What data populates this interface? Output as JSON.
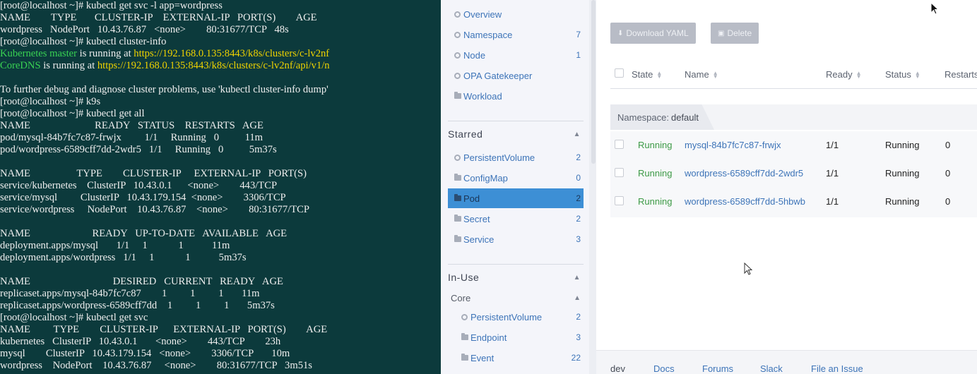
{
  "terminal": {
    "lines": [
      [
        {
          "t": "[root@localhost ~]# kubectl get svc -l app=wordpress"
        }
      ],
      [
        {
          "t": "NAME        TYPE       CLUSTER-IP    EXTERNAL-IP   PORT(S)        AGE"
        }
      ],
      [
        {
          "t": "wordpress   NodePort   10.43.76.87   <none>        80:31677/TCP   48s"
        }
      ],
      [
        {
          "t": "[root@localhost ~]# kubectl cluster-info"
        }
      ],
      [
        {
          "t": "Kubernetes master",
          "c": "g"
        },
        {
          "t": " is running at "
        },
        {
          "t": "https://192.168.0.135:8443/k8s/clusters/c-lv2nf",
          "c": "y"
        }
      ],
      [
        {
          "t": "CoreDNS",
          "c": "g"
        },
        {
          "t": " is running at "
        },
        {
          "t": "https://192.168.0.135:8443/k8s/clusters/c-lv2nf/api/v1/n",
          "c": "y"
        }
      ],
      [
        {
          "t": ""
        }
      ],
      [
        {
          "t": "To further debug and diagnose cluster problems, use 'kubectl cluster-info dump'"
        }
      ],
      [
        {
          "t": "[root@localhost ~]# k9s"
        }
      ],
      [
        {
          "t": "[root@localhost ~]# kubectl get all"
        }
      ],
      [
        {
          "t": "NAME                         READY   STATUS    RESTARTS   AGE"
        }
      ],
      [
        {
          "t": "pod/mysql-84b7fc7c87-frwjx         1/1     Running   0          11m"
        }
      ],
      [
        {
          "t": "pod/wordpress-6589cff7dd-2wdr5   1/1     Running   0          5m37s"
        }
      ],
      [
        {
          "t": ""
        }
      ],
      [
        {
          "t": "NAME                  TYPE        CLUSTER-IP     EXTERNAL-IP   PORT(S)"
        }
      ],
      [
        {
          "t": "service/kubernetes    ClusterIP   10.43.0.1      <none>        443/TCP"
        }
      ],
      [
        {
          "t": "service/mysql         ClusterIP   10.43.179.154  <none>        3306/TCP"
        }
      ],
      [
        {
          "t": "service/wordpress     NodePort    10.43.76.87    <none>        80:31677/TCP"
        }
      ],
      [
        {
          "t": ""
        }
      ],
      [
        {
          "t": "NAME                        READY   UP-TO-DATE   AVAILABLE   AGE"
        }
      ],
      [
        {
          "t": "deployment.apps/mysql       1/1     1            1           11m"
        }
      ],
      [
        {
          "t": "deployment.apps/wordpress   1/1     1            1           5m37s"
        }
      ],
      [
        {
          "t": ""
        }
      ],
      [
        {
          "t": "NAME                                DESIRED   CURRENT   READY   AGE"
        }
      ],
      [
        {
          "t": "replicaset.apps/mysql-84b7fc7c87        1         1         1       11m"
        }
      ],
      [
        {
          "t": "replicaset.apps/wordpress-6589cff7dd    1         1         1       5m37s"
        }
      ],
      [
        {
          "t": "[root@localhost ~]# kubectl get svc"
        }
      ],
      [
        {
          "t": "NAME         TYPE        CLUSTER-IP      EXTERNAL-IP   PORT(S)        AGE"
        }
      ],
      [
        {
          "t": "kubernetes   ClusterIP   10.43.0.1       <none>        443/TCP        23h"
        }
      ],
      [
        {
          "t": "mysql        ClusterIP   10.43.179.154   <none>        3306/TCP       10m"
        }
      ],
      [
        {
          "t": "wordpress    NodePort    10.43.76.87     <none>        80:31677/TCP   3m51s"
        }
      ]
    ]
  },
  "sidebar": {
    "top_items": [
      {
        "label": "Overview",
        "count": "",
        "icon": "circle"
      },
      {
        "label": "Namespace",
        "count": "7",
        "icon": "circle"
      },
      {
        "label": "Node",
        "count": "1",
        "icon": "circle"
      },
      {
        "label": "OPA Gatekeeper",
        "count": "",
        "icon": "circle"
      },
      {
        "label": "Workload",
        "count": "",
        "icon": "folder"
      }
    ],
    "starred_title": "Starred",
    "starred_items": [
      {
        "label": "PersistentVolume",
        "count": "2",
        "icon": "circle"
      },
      {
        "label": "ConfigMap",
        "count": "0",
        "icon": "folder"
      },
      {
        "label": "Pod",
        "count": "2",
        "icon": "folder",
        "active": true
      },
      {
        "label": "Secret",
        "count": "2",
        "icon": "folder"
      },
      {
        "label": "Service",
        "count": "3",
        "icon": "folder"
      }
    ],
    "inuse_title": "In-Use",
    "core_title": "Core",
    "core_items": [
      {
        "label": "PersistentVolume",
        "count": "2",
        "icon": "circle"
      },
      {
        "label": "Endpoint",
        "count": "3",
        "icon": "folder"
      },
      {
        "label": "Event",
        "count": "22",
        "icon": "folder"
      }
    ]
  },
  "main": {
    "download_label": "Download YAML",
    "delete_label": "Delete",
    "columns": [
      "State",
      "Name",
      "Ready",
      "Status",
      "Restarts"
    ],
    "group_label": "Namespace:",
    "group_value": "default",
    "rows": [
      {
        "state": "Running",
        "name": "mysql-84b7fc7c87-frwjx",
        "ready": "1/1",
        "status": "Running",
        "restarts": "0"
      },
      {
        "state": "Running",
        "name": "wordpress-6589cff7dd-2wdr5",
        "ready": "1/1",
        "status": "Running",
        "restarts": "0"
      },
      {
        "state": "Running",
        "name": "wordpress-6589cff7dd-5hbwb",
        "ready": "1/1",
        "status": "Running",
        "restarts": "0"
      }
    ],
    "footer_links": [
      "dev",
      "Docs",
      "Forums",
      "Slack",
      "File an Issue"
    ]
  },
  "colors": {
    "terminal_bg": "#0c3a3c",
    "terminal_green": "#39d353",
    "terminal_yellow": "#f0d300",
    "accent_blue": "#3d8fd5",
    "link_blue": "#3d74b8",
    "running_green": "#3d9a46"
  }
}
